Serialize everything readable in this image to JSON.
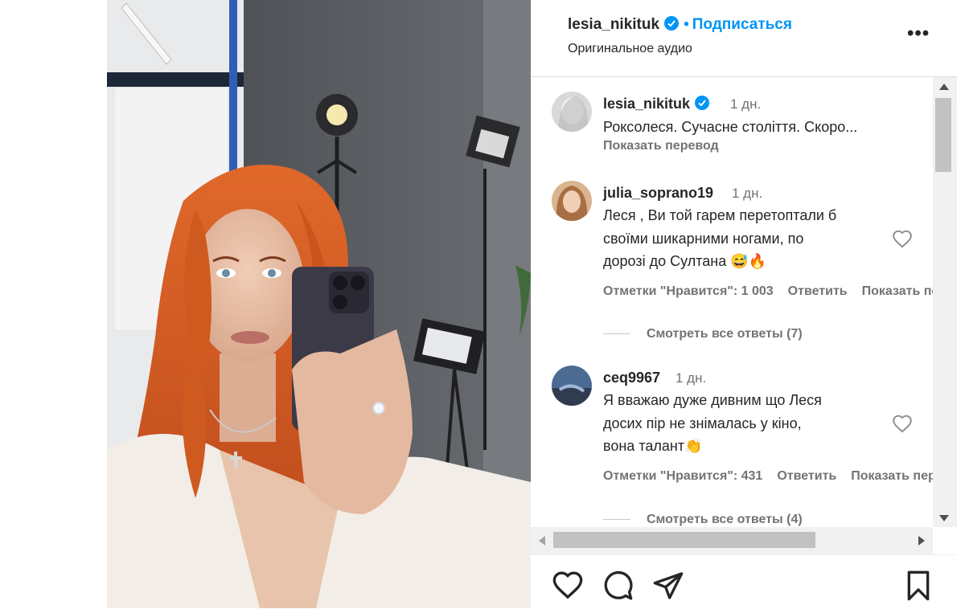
{
  "header": {
    "username": "lesia_nikituk",
    "dot": "•",
    "follow_label": "Подписаться",
    "audio_label": "Оригинальное аудио",
    "more_label": "•••"
  },
  "comments": [
    {
      "username": "lesia_nikituk",
      "time": "1 дн.",
      "text": "Роксолеся. Сучасне століття. Скоро...",
      "translate_label": "Показать перевод"
    },
    {
      "username": "julia_soprano19",
      "time": "1 дн.",
      "text": "Леся , Ви той гарем перетоптали б\nсвоїми шикарними ногами, по\nдорозі до Султана 😅🔥",
      "likes_label": "Отметки \"Нравится\": 1 003",
      "reply_label": "Ответить",
      "show_label": "Показать перевод",
      "replies_label": "Смотреть все ответы (7)"
    },
    {
      "username": "ceq9967",
      "time": "1 дн.",
      "text": "Я вважаю дуже дивним що Леся\nдосих пір не знімалась у кіно,\nвона талант👏",
      "likes_label": "Отметки \"Нравится\": 431",
      "reply_label": "Ответить",
      "show_label": "Показать перевод",
      "replies_label": "Смотреть все ответы (4)"
    }
  ],
  "colors": {
    "accent": "#0095f6",
    "text": "#262626",
    "secondary": "#737373",
    "hair": "#d2551e",
    "wall": "#5d6066"
  },
  "icons": [
    "verified-icon",
    "heart-icon",
    "comment-icon",
    "share-icon",
    "bookmark-icon"
  ]
}
